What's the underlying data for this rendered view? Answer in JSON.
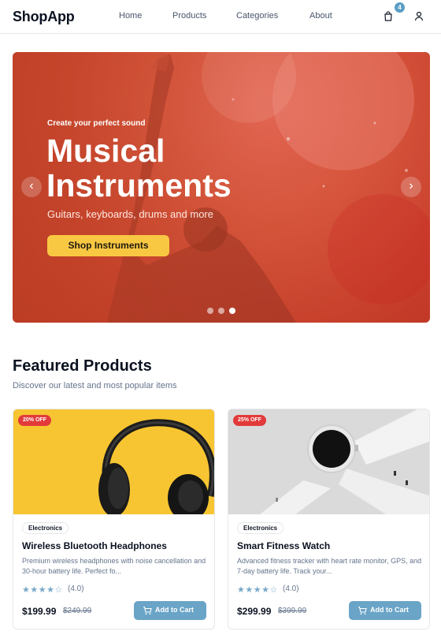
{
  "header": {
    "logo": "ShopApp",
    "nav": [
      "Home",
      "Products",
      "Categories",
      "About"
    ],
    "cart_count": "4",
    "cart_icon": "shopping-bag-icon",
    "user_icon": "user-icon"
  },
  "hero": {
    "kicker": "Create your perfect sound",
    "title": "Musical Instruments",
    "subtitle": "Guitars, keyboards, drums and more",
    "cta": "Shop Instruments",
    "prev": "‹",
    "next": "›",
    "slides": 3,
    "active_slide": 3
  },
  "featured": {
    "title": "Featured Products",
    "subtitle": "Discover our latest and most popular items"
  },
  "products": [
    {
      "discount": "20% OFF",
      "category": "Electronics",
      "name": "Wireless Bluetooth Headphones",
      "description": "Premium wireless headphones with noise cancellation and 30-hour battery life. Perfect fo...",
      "stars": "★★★★☆",
      "rating": "(4.0)",
      "price": "$199.99",
      "old_price": "$249.99",
      "button": "Add to Cart"
    },
    {
      "discount": "25% OFF",
      "category": "Electronics",
      "name": "Smart Fitness Watch",
      "description": "Advanced fitness tracker with heart rate monitor, GPS, and 7-day battery life. Track your...",
      "stars": "★★★★☆",
      "rating": "(4.0)",
      "price": "$299.99",
      "old_price": "$399.99",
      "button": "Add to Cart"
    }
  ],
  "colors": {
    "accent": "#6aa4c7",
    "cta_yellow": "#f9c843",
    "discount_red": "#e23a3a",
    "hero_red": "#d8573e"
  }
}
